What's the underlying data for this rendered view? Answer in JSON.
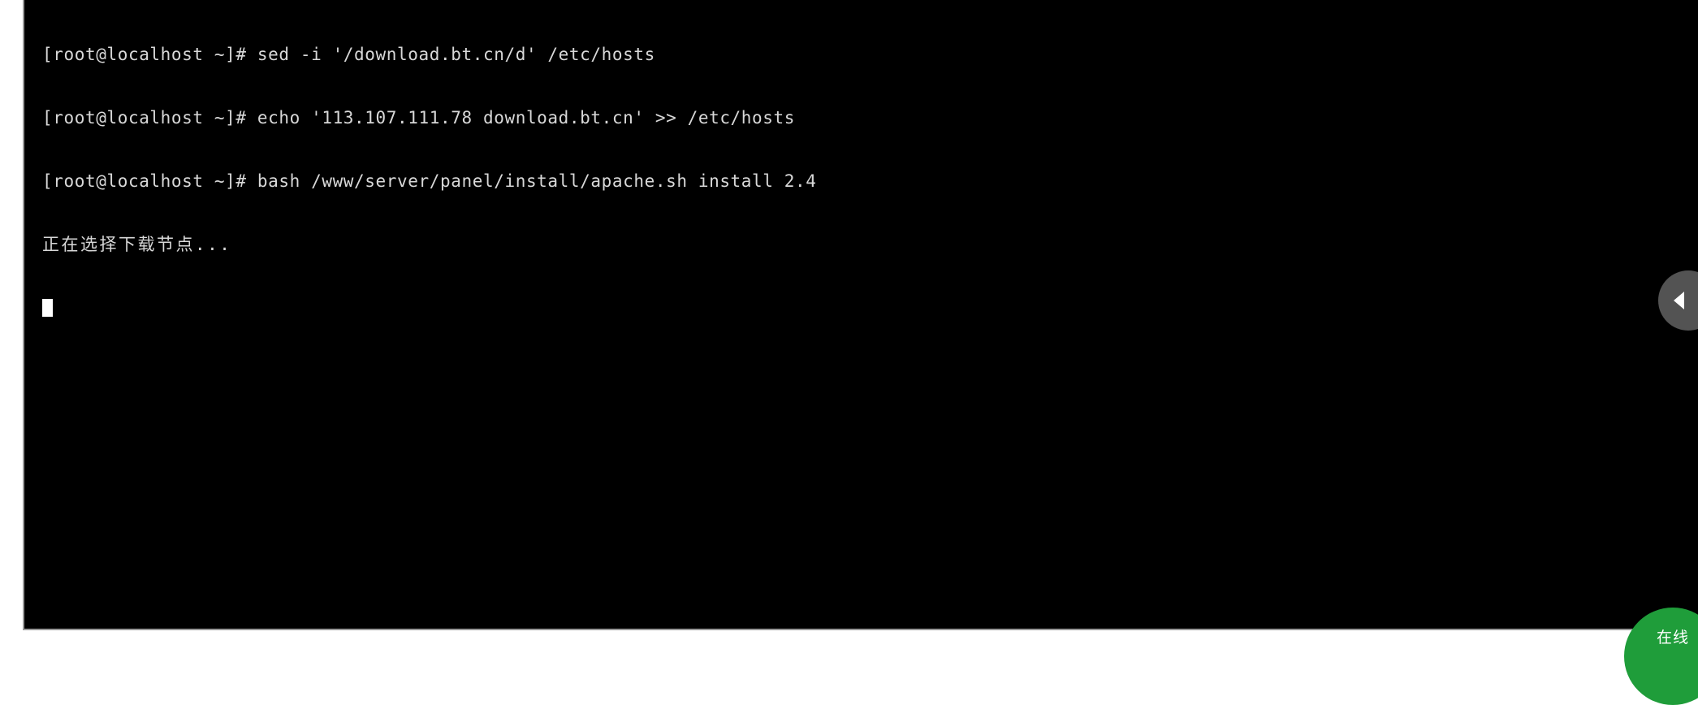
{
  "terminal": {
    "background_color": "#000000",
    "text_color": "#d8d8d8",
    "lines": [
      "[root@localhost ~]# sed -i '/download.bt.cn/d' /etc/hosts",
      "[root@localhost ~]# echo '113.107.111.78 download.bt.cn' >> /etc/hosts",
      "[root@localhost ~]# bash /www/server/panel/install/apache.sh install 2.4",
      "正在选择下载节点..."
    ],
    "cursor": {
      "name": "block-cursor",
      "color": "#ffffff"
    }
  },
  "collapse_handle": {
    "icon": "chevron-left-icon",
    "background_color": "#535353",
    "arrow_color": "#ffffff"
  },
  "float_bubble": {
    "label": "在线",
    "background_color": "#1f9d3a",
    "text_color": "#ffffff"
  }
}
